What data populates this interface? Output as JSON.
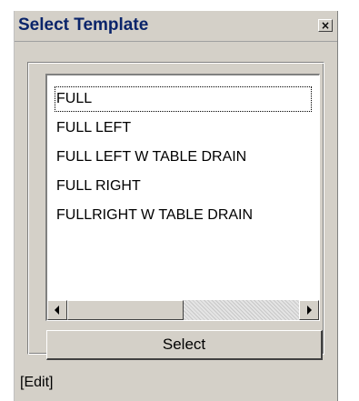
{
  "window": {
    "title": "Select Template",
    "close_label": "×"
  },
  "template_list": {
    "items": [
      {
        "label": "FULL",
        "selected": true
      },
      {
        "label": "FULL LEFT",
        "selected": false
      },
      {
        "label": "FULL LEFT W TABLE DRAIN",
        "selected": false
      },
      {
        "label": "FULL RIGHT",
        "selected": false
      },
      {
        "label": "FULLRIGHT W TABLE DRAIN",
        "selected": false
      }
    ]
  },
  "scrollbar": {
    "left_icon": "arrow-left-icon",
    "right_icon": "arrow-right-icon"
  },
  "actions": {
    "select_label": "Select"
  },
  "status": {
    "text": "[Edit]"
  },
  "colors": {
    "face": "#d4d0c8",
    "title_text": "#0a246a"
  }
}
